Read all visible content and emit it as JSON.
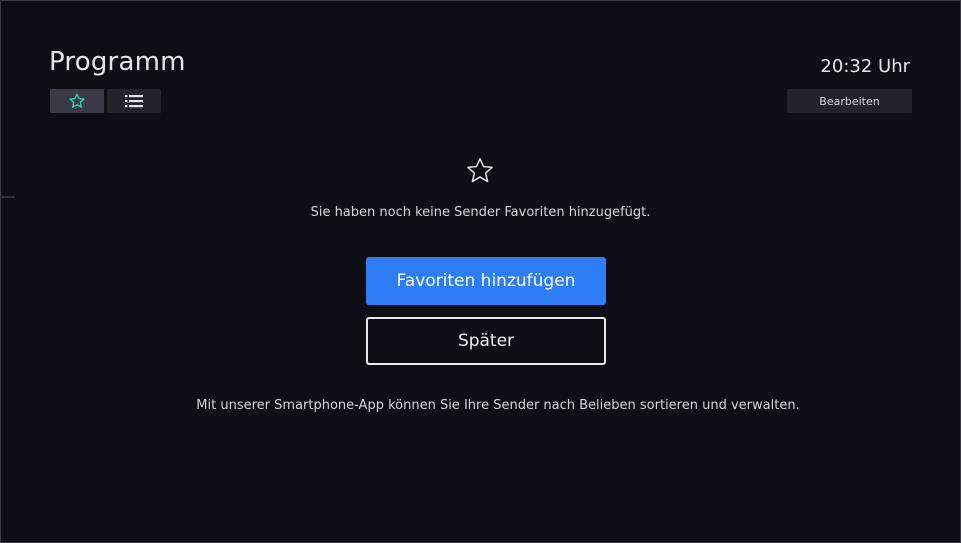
{
  "header": {
    "title": "Programm",
    "clock": "20:32 Uhr",
    "edit_label": "Bearbeiten",
    "view_toggle": [
      {
        "icon": "star-icon",
        "state": "active"
      },
      {
        "icon": "list-icon",
        "state": "inactive"
      }
    ]
  },
  "empty_state": {
    "icon": "star-outline-icon",
    "message": "Sie haben noch keine Sender Favoriten hinzugefügt.",
    "primary_label": "Favoriten hinzufügen",
    "secondary_label": "Später",
    "hint": "Mit unserer Smartphone-App können Sie Ihre Sender nach Belieben sortieren und verwalten."
  },
  "colors": {
    "background": "#0f0e17",
    "accent": "#2d7df4",
    "active_icon": "#2fd6b0"
  }
}
